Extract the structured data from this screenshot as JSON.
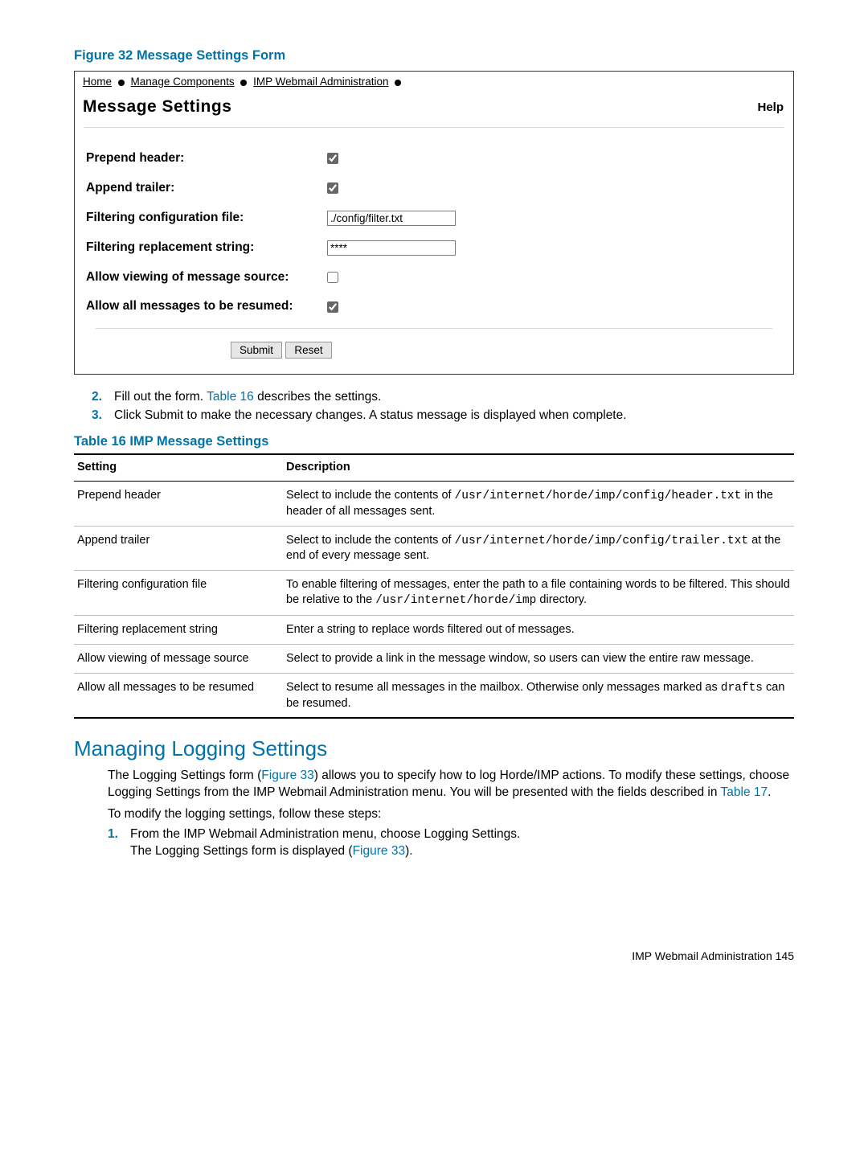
{
  "figure_title": "Figure 32 Message Settings Form",
  "breadcrumb": {
    "home": "Home",
    "mc": "Manage Components",
    "imp": "IMP Webmail Administration"
  },
  "panel": {
    "title": "Message Settings",
    "help": "Help"
  },
  "form": {
    "prepend_label": "Prepend header:",
    "append_label": "Append trailer:",
    "filterfile_label": "Filtering configuration file:",
    "filterfile_value": "./config/filter.txt",
    "filterrepl_label": "Filtering replacement string:",
    "filterrepl_value": "****",
    "viewsrc_label": "Allow viewing of message source:",
    "resume_label": "Allow all messages to be resumed:",
    "submit": "Submit",
    "reset": "Reset"
  },
  "steps1": {
    "n2": "2.",
    "t2a": "Fill out the form. ",
    "t2link": "Table 16",
    "t2b": " describes the settings.",
    "n3": "3.",
    "t3": "Click Submit to make the necessary changes. A status message is displayed when complete."
  },
  "table_title": "Table 16 IMP Message Settings",
  "th_setting": "Setting",
  "th_desc": "Description",
  "rows": [
    {
      "s": "Prepend header",
      "d_pre": "Select to include the contents of ",
      "d_code": "/usr/internet/horde/imp/config/header.txt",
      "d_post": " in the header of all messages sent."
    },
    {
      "s": "Append trailer",
      "d_pre": "Select to include the contents of ",
      "d_code": "/usr/internet/horde/imp/config/trailer.txt",
      "d_post": " at the end of every message sent."
    },
    {
      "s": "Filtering configuration file",
      "d_pre": "To enable filtering of messages, enter the path to a file containing words to be filtered. This should be relative to the ",
      "d_code": "/usr/internet/horde/imp",
      "d_post": " directory."
    },
    {
      "s": "Filtering replacement string",
      "d_pre": "Enter a string to replace words filtered out of messages.",
      "d_code": "",
      "d_post": ""
    },
    {
      "s": "Allow viewing of message source",
      "d_pre": "Select to provide a link in the message window, so users can view the entire raw message.",
      "d_code": "",
      "d_post": ""
    },
    {
      "s": "Allow all messages to be resumed",
      "d_pre": "Select to resume all messages in the mailbox. Otherwise only messages marked as ",
      "d_code": "drafts",
      "d_post": " can be resumed."
    }
  ],
  "section_heading": "Managing Logging Settings",
  "para1a": "The Logging Settings form (",
  "para1link1": "Figure 33",
  "para1b": ") allows you to specify how to log Horde/IMP actions. To modify these settings, choose Logging Settings from the IMP Webmail Administration menu. You will be presented with the fields described in ",
  "para1link2": "Table 17",
  "para1c": ".",
  "para2": "To modify the logging settings, follow these steps:",
  "steps2": {
    "n1": "1.",
    "t1": "From the IMP Webmail Administration menu, choose Logging Settings.",
    "t1b_a": "The Logging Settings form is displayed (",
    "t1b_link": "Figure 33",
    "t1b_b": ")."
  },
  "footer": "IMP Webmail Administration    145"
}
